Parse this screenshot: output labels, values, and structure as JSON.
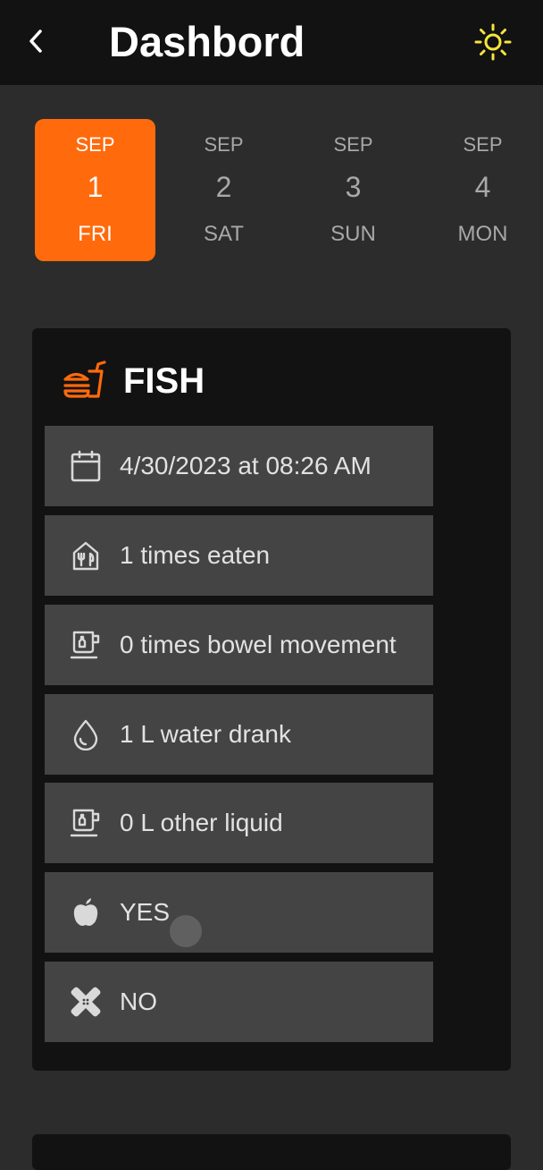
{
  "header": {
    "title": "Dashbord",
    "back_icon": "chevron-left-icon",
    "theme_icon": "sun-icon",
    "theme_color": "#f6e43c"
  },
  "calendar": {
    "accent": "#ff6a0c",
    "days": [
      {
        "month": "SEP",
        "day": "1",
        "weekday": "FRI",
        "selected": true
      },
      {
        "month": "SEP",
        "day": "2",
        "weekday": "SAT",
        "selected": false
      },
      {
        "month": "SEP",
        "day": "3",
        "weekday": "SUN",
        "selected": false
      },
      {
        "month": "SEP",
        "day": "4",
        "weekday": "MON",
        "selected": false
      }
    ]
  },
  "entry": {
    "title": "FISH",
    "icon": "fast-food-icon",
    "rows": [
      {
        "icon": "calendar-icon",
        "text": "4/30/2023 at 08:26 AM"
      },
      {
        "icon": "restaurant-icon",
        "text": "1 times eaten"
      },
      {
        "icon": "cup-icon",
        "text": "0 times bowel movement"
      },
      {
        "icon": "water-drop-icon",
        "text": "1 L water drank"
      },
      {
        "icon": "cup-icon",
        "text": "0 L other liquid"
      },
      {
        "icon": "apple-icon",
        "text": "YES"
      },
      {
        "icon": "bandage-icon",
        "text": "NO"
      }
    ]
  }
}
